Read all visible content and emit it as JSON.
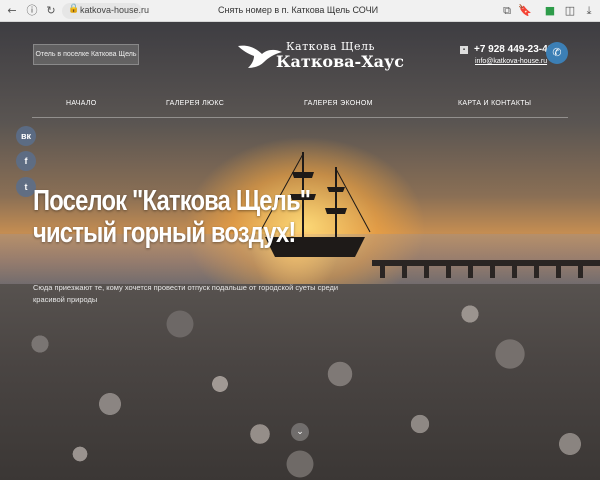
{
  "browser": {
    "url": "katkova-house.ru",
    "tab_title": "Снять номер в п. Каткова Щель СОЧИ",
    "icons": [
      "back-icon",
      "info-icon",
      "reload-icon",
      "lock-icon",
      "translate-icon",
      "bookmark-icon",
      "extension-icon",
      "download-icon"
    ]
  },
  "header": {
    "location_button": "Отель в поселке Каткова Щель",
    "logo_top": "Каткова Щель",
    "logo_main": "Каткова-Хаус",
    "phone": "+7 928 449-23-49",
    "email": "info@katkova-house.ru"
  },
  "nav": {
    "items": [
      "НАЧАЛО",
      "ГАЛЕРЕЯ ЛЮКС",
      "ГАЛЕРЕЯ ЭКОНОМ",
      "КАРТА И КОНТАКТЫ"
    ]
  },
  "social": [
    "vk",
    "f",
    "twitter"
  ],
  "hero": {
    "headline_line1": "Поселок \"Каткова Щель\"",
    "headline_line2": "чистый горный воздух!",
    "subtext": "Сюда приезжают те, кому хочется провести отпуск подальше от городской суеты среди красивой природы"
  }
}
